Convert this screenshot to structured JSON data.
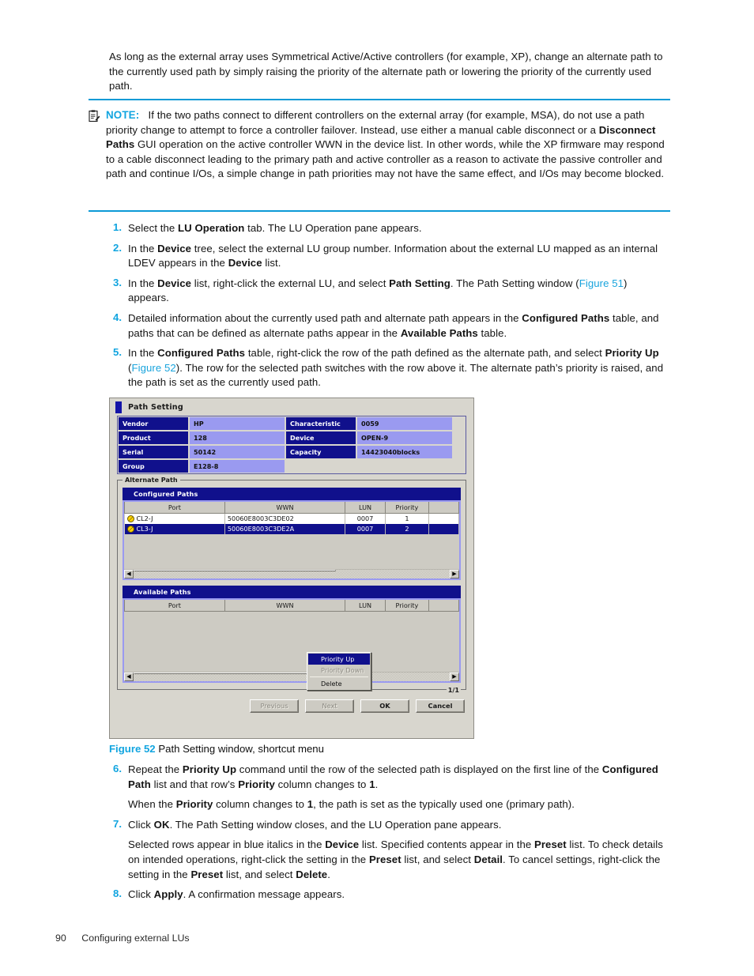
{
  "intro": {
    "text": "As long as the external array uses Symmetrical Active/Active controllers (for example, XP), change an alternate path to the currently used path by simply raising the priority of the alternate path or lowering the priority of the currently used path."
  },
  "note": {
    "icon": "note-clipboard-icon",
    "label": "NOTE:",
    "text": "If the two paths connect to different controllers on the external array (for example, MSA), do not use a path priority change to attempt to force a controller failover. Instead, use either a manual cable disconnect or a Disconnect Paths GUI operation on the active controller WWN in the device list. In other words, while the XP firmware may respond to a cable disconnect leading to the primary path and active controller as a reason to activate the passive controller and path and continue I/Os, a simple change in path priorities may not have the same effect, and I/Os may become blocked.",
    "bold_terms": [
      "Disconnect Paths"
    ]
  },
  "steps_top": [
    {
      "num": "1.",
      "html": "Select the <b>LU Operation</b> tab. The LU Operation pane appears."
    },
    {
      "num": "2.",
      "html": "In the <b>Device</b> tree, select the external LU group number. Information about the external LU mapped as an internal LDEV appears in the <b>Device</b> list."
    },
    {
      "num": "3.",
      "html": "In the <b>Device</b> list, right-click the external LU, and select <b>Path Setting</b>. The Path Setting window (<span class=\"xref\">Figure 51</span>) appears."
    },
    {
      "num": "4.",
      "html": "Detailed information about the currently used path and alternate path appears in the <b>Configured Paths</b> table, and paths that can be defined as alternate paths appear in the <b>Available Paths</b> table."
    },
    {
      "num": "5.",
      "html": "In the <b>Configured Paths</b> table, right-click the row of the path defined as the alternate path, and select <b>Priority Up</b> (<span class=\"xref\">Figure 52</span>). The row for the selected path switches with the row above it. The alternate path&rsquo;s priority is raised, and the path is set as the currently used path."
    }
  ],
  "steps_bottom": [
    {
      "num": "6.",
      "html": "Repeat the <b>Priority Up</b> command until the row of the selected path is displayed on the first line of the <b>Configured Path</b> list and that row&rsquo;s <b>Priority</b> column changes to <b>1</b>.",
      "sub": "When the <b>Priority</b> column changes to <b>1</b>, the path is set as the typically used one (primary path)."
    },
    {
      "num": "7.",
      "html": "Click <b>OK</b>. The Path Setting window closes, and the LU Operation pane appears.",
      "sub": "Selected rows appear in blue italics in the <b>Device</b> list. Specified contents appear in the <b>Preset</b> list. To check details on intended operations, right-click the setting in the <b>Preset</b> list, and select <b>Detail</b>. To cancel settings, right-click the setting in the <b>Preset</b> list, and select <b>Delete</b>."
    },
    {
      "num": "8.",
      "html": "Click <b>Apply</b>. A confirmation message appears.",
      "sub": ""
    }
  ],
  "figure": {
    "label": "Figure 52",
    "caption": "Path Setting window, shortcut menu"
  },
  "dialog": {
    "title": "Path Setting",
    "info": [
      {
        "label": "Vendor",
        "value": "HP",
        "label2": "Characteristic",
        "value2": "0059"
      },
      {
        "label": "Product",
        "value": "128",
        "label2": "Device",
        "value2": "OPEN-9"
      },
      {
        "label": "Serial",
        "value": "50142",
        "label2": "Capacity",
        "value2": "14423040blocks"
      },
      {
        "label": "Group",
        "value": "E128-8",
        "label2": "",
        "value2": ""
      }
    ],
    "fieldset_legend": "Alternate Path",
    "configured": {
      "title": "Configured Paths",
      "columns": [
        "Port",
        "WWN",
        "LUN",
        "Priority",
        ""
      ],
      "rows": [
        {
          "port": "CL2-J",
          "wwn": "50060E8003C3DE02",
          "lun": "0007",
          "priority": "1",
          "selected": false
        },
        {
          "port": "CL3-J",
          "wwn": "50060E8003C3DE2A",
          "lun": "0007",
          "priority": "2",
          "selected": true
        }
      ]
    },
    "available": {
      "title": "Available Paths",
      "columns": [
        "Port",
        "WWN",
        "LUN",
        "Priority",
        ""
      ],
      "rows": []
    },
    "context_menu": [
      {
        "label": "Priority Up",
        "state": "highlighted"
      },
      {
        "label": "Priority Down",
        "state": "disabled"
      },
      {
        "label": "Delete",
        "state": "normal"
      }
    ],
    "page_counter": "1/1",
    "buttons": [
      {
        "label": "Previous",
        "state": "disabled"
      },
      {
        "label": "Next",
        "state": "disabled"
      },
      {
        "label": "OK",
        "state": "normal"
      },
      {
        "label": "Cancel",
        "state": "normal"
      }
    ]
  },
  "footer": {
    "page_number": "90",
    "chapter": "Configuring external LUs"
  },
  "colors": {
    "accent_cyan": "#12a5e0",
    "dialog_header_blue": "#10108c",
    "dialog_value_blue": "#9a9af0",
    "dialog_face": "#d8d6ce"
  }
}
